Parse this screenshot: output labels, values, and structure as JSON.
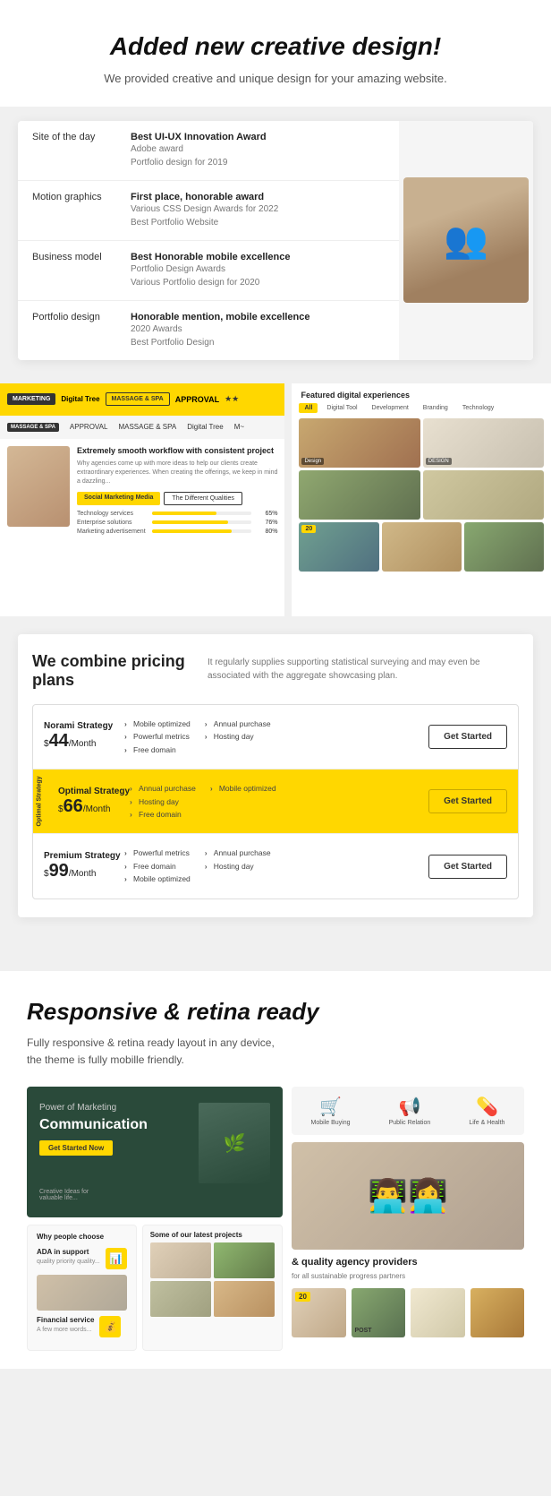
{
  "hero": {
    "title": "Added new creative design!",
    "subtitle": "We provided creative and unique  design for your amazing website."
  },
  "awards": {
    "items": [
      {
        "category": "Site of the day",
        "title": "Best UI-UX Innovation Award",
        "details": "Adobe award\nPortfolio design for 2019"
      },
      {
        "category": "Motion graphics",
        "title": "First place, honorable award",
        "details": "Various CSS Design Awards for 2022\nBest Portfolio Website"
      },
      {
        "category": "Business model",
        "title": "Best Honorable mobile excellence",
        "details": "Portfolio Design Awards\nVarious Portfolio design for 2020"
      },
      {
        "category": "Portfolio design",
        "title": "Honorable mention, mobile excellence",
        "details": "2020 Awards\nBest Portfolio Design"
      }
    ]
  },
  "showcase": {
    "headline": "Extremely smooth workflow with consistent project",
    "desc": "Why agencies come up with more ideas to help our clients create extraordinary experiences. When creating the offerings, we keep in mind a dazzling and stunning high-quality portfolio to enhance your website",
    "btn1": "Social Marketing Media",
    "btn2": "The Different Qualities",
    "progress_items": [
      {
        "label": "Technology services",
        "value": 65
      },
      {
        "label": "Enterprise solutions",
        "value": 76
      },
      {
        "label": "Marketing advertisement",
        "value": 80
      }
    ],
    "featured": {
      "title": "Featured digital experiences",
      "tabs": [
        "All",
        "Digital Tool",
        "Development",
        "Branding",
        "Technology"
      ]
    }
  },
  "pricing": {
    "title": "We combine pricing plans",
    "desc": "It regularly supplies supporting statistical surveying and may even be associated with the aggregate showcasing plan.",
    "plans": [
      {
        "name": "Norami Strategy",
        "price": "44",
        "period": "/Month",
        "features_left": [
          "Mobile optimized",
          "Powerful metrics",
          "Free domain"
        ],
        "features_right": [
          "Annual purchase",
          "Hosting day"
        ],
        "btn": "Get Started",
        "highlighted": false
      },
      {
        "name": "Optimal Strategy",
        "price": "66",
        "period": "/Month",
        "features_left": [
          "Annual purchase",
          "Hosting day",
          "Free domain"
        ],
        "features_right": [
          "Mobile optimized"
        ],
        "btn": "Get Started",
        "highlighted": true,
        "side_label": "Optimal Strategy"
      },
      {
        "name": "Premium Strategy",
        "price": "99",
        "period": "/Month",
        "features_left": [
          "Powerful metrics",
          "Free domain",
          "Mobile optimized"
        ],
        "features_right": [
          "Annual purchase",
          "Hosting day"
        ],
        "btn": "Get Started",
        "highlighted": false
      }
    ]
  },
  "responsive": {
    "title": "Responsive & retina ready",
    "subtitle": "Fully responsive & retina ready layout in any device,\nthe theme is fully mobille friendly.",
    "marketing_card": {
      "pre_text": "Power of",
      "headline_normal": "",
      "headline_yellow": "Marketing",
      "headline_rest": "Communication",
      "btn": "Get Started Now"
    },
    "icons": [
      {
        "icon": "🛒",
        "label": "Mobile Buying"
      },
      {
        "icon": "📢",
        "label": "Public Relation"
      },
      {
        "icon": "💊",
        "label": "Life & Health"
      }
    ],
    "why": {
      "title": "Why people choose",
      "items": [
        {
          "icon": "📊",
          "label": "ADA in support",
          "desc": "quality, priority, quality..."
        },
        {
          "icon": "💰",
          "label": "Financial service",
          "desc": "A few more words"
        }
      ]
    },
    "latest": {
      "title": "Some of our latest projects"
    },
    "quality": {
      "title": "& quality agency providers",
      "desc": "for all sustainable progress partners"
    }
  }
}
